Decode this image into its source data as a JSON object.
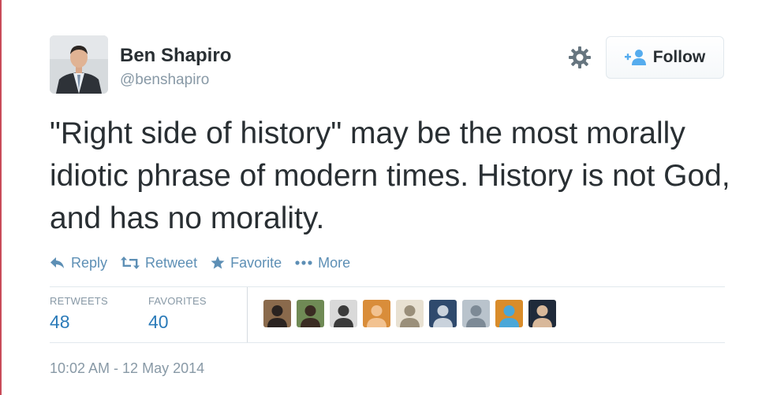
{
  "colors": {
    "link_blue": "#5d8fb5",
    "count_blue": "#2b7bb9",
    "muted_gray": "#8899a6",
    "text_dark": "#292f33"
  },
  "author": {
    "name": "Ben Shapiro",
    "handle": "@benshapiro"
  },
  "header": {
    "settings_icon": "gear-icon",
    "follow_label": "Follow",
    "follow_icon": "add-user-icon"
  },
  "tweet": {
    "text": "\"Right side of history\" may be the most morally idiotic phrase of modern times. History is not God, and has no morality."
  },
  "actions": [
    {
      "icon": "reply-icon",
      "label": "Reply"
    },
    {
      "icon": "retweet-icon",
      "label": "Retweet"
    },
    {
      "icon": "star-icon",
      "label": "Favorite"
    },
    {
      "icon": "more-dots-icon",
      "label": "More"
    }
  ],
  "stats": {
    "retweets_label": "RETWEETS",
    "retweets_count": "48",
    "favorites_label": "FAVORITES",
    "favorites_count": "40"
  },
  "favoriters": [
    {
      "bg": "#8a6a4c",
      "fg": "#2a2320"
    },
    {
      "bg": "#6f8a55",
      "fg": "#3a2b22"
    },
    {
      "bg": "#d9d9d9",
      "fg": "#3b3b3b"
    },
    {
      "bg": "#d98d3a",
      "fg": "#f2c290"
    },
    {
      "bg": "#e8e1d2",
      "fg": "#9a8f7a"
    },
    {
      "bg": "#2f4a6d",
      "fg": "#c9d2dc"
    },
    {
      "bg": "#b9c3cc",
      "fg": "#7d8a96"
    },
    {
      "bg": "#d98c2a",
      "fg": "#4aa7d8"
    },
    {
      "bg": "#1f2a3a",
      "fg": "#d8b89a"
    }
  ],
  "meta": {
    "timestamp": "10:02 AM - 12 May 2014"
  }
}
